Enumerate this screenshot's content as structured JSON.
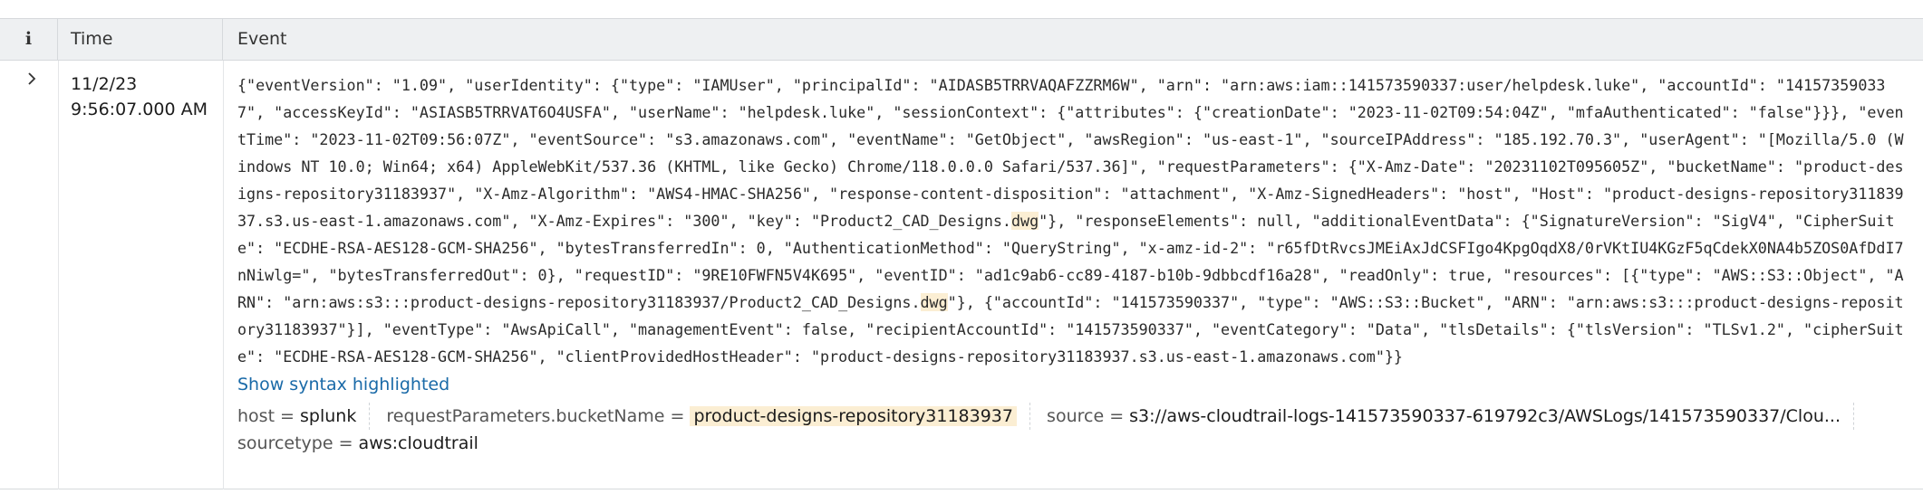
{
  "columns": {
    "info": "i",
    "time": "Time",
    "event": "Event"
  },
  "row": {
    "date": "11/2/23",
    "time": "9:56:07.000 AM",
    "raw_parts": [
      "{\"eventVersion\": \"1.09\", \"userIdentity\": {\"type\": \"IAMUser\", \"principalId\": \"AIDASB5TRRVAQAFZZRM6W\", \"arn\": \"arn:aws:iam::141573590337:user/helpdesk.luke\", \"accountId\": \"141573590337\", \"accessKeyId\": \"ASIASB5TRRVAT6O4USFA\", \"userName\": \"helpdesk.luke\", \"sessionContext\": {\"attributes\": {\"creationDate\": \"2023-11-02T09:54:04Z\", \"mfaAuthenticated\": \"false\"}}}, \"eventTime\": \"2023-11-02T09:56:07Z\", \"eventSource\": \"s3.amazonaws.com\", \"eventName\": \"GetObject\", \"awsRegion\": \"us-east-1\", \"sourceIPAddress\": \"185.192.70.3\", \"userAgent\": \"[Mozilla/5.0 (Windows NT 10.0; Win64; x64) AppleWebKit/537.36 (KHTML, like Gecko) Chrome/118.0.0.0 Safari/537.36]\", \"requestParameters\": {\"X-Amz-Date\": \"20231102T095605Z\", \"bucketName\": \"product-designs-repository31183937\", \"X-Amz-Algorithm\": \"AWS4-HMAC-SHA256\", \"response-content-disposition\": \"attachment\", \"X-Amz-SignedHeaders\": \"host\", \"Host\": \"product-designs-repository31183937.s3.us-east-1.amazonaws.com\", \"X-Amz-Expires\": \"300\", \"key\": \"Product2_CAD_Designs.",
      "dwg",
      "\"}, \"responseElements\": null, \"additionalEventData\": {\"SignatureVersion\": \"SigV4\", \"CipherSuite\": \"ECDHE-RSA-AES128-GCM-SHA256\", \"bytesTransferredIn\": 0, \"AuthenticationMethod\": \"QueryString\", \"x-amz-id-2\": \"r65fDtRvcsJMEiAxJdCSFIgo4KpgOqdX8/0rVKtIU4KGzF5qCdekX0NA4b5ZOS0AfDdI7nNiwlg=\", \"bytesTransferredOut\": 0}, \"requestID\": \"9RE10FWFN5V4K695\", \"eventID\": \"ad1c9ab6-cc89-4187-b10b-9dbbcdf16a28\", \"readOnly\": true, \"resources\": [{\"type\": \"AWS::S3::Object\", \"ARN\": \"arn:aws:s3:::product-designs-repository31183937/Product2_CAD_Designs.",
      "dwg",
      "\"}, {\"accountId\": \"141573590337\", \"type\": \"AWS::S3::Bucket\", \"ARN\": \"arn:aws:s3:::product-designs-repository31183937\"}], \"eventType\": \"AwsApiCall\", \"managementEvent\": false, \"recipientAccountId\": \"141573590337\", \"eventCategory\": \"Data\", \"tlsDetails\": {\"tlsVersion\": \"TLSv1.2\", \"cipherSuite\": \"ECDHE-RSA-AES128-GCM-SHA256\", \"clientProvidedHostHeader\": \"product-designs-repository31183937.s3.us-east-1.amazonaws.com\"}}"
    ],
    "syntax_link": "Show syntax highlighted",
    "fields": [
      {
        "key": "host",
        "value": "splunk",
        "highlighted": false
      },
      {
        "key": "requestParameters.bucketName",
        "value": "product-designs-repository31183937",
        "highlighted": true
      },
      {
        "key": "source",
        "value": "s3://aws-cloudtrail-logs-141573590337-619792c3/AWSLogs/141573590337/Clou...",
        "highlighted": false
      },
      {
        "key": "sourcetype",
        "value": "aws:cloudtrail",
        "highlighted": false
      }
    ],
    "field_separator": " = "
  },
  "colors": {
    "header_bg": "#eef0f2",
    "highlight": "#fbeed3",
    "link": "#1a6aa8"
  },
  "icons": {
    "expand": "chevron-right-icon"
  }
}
